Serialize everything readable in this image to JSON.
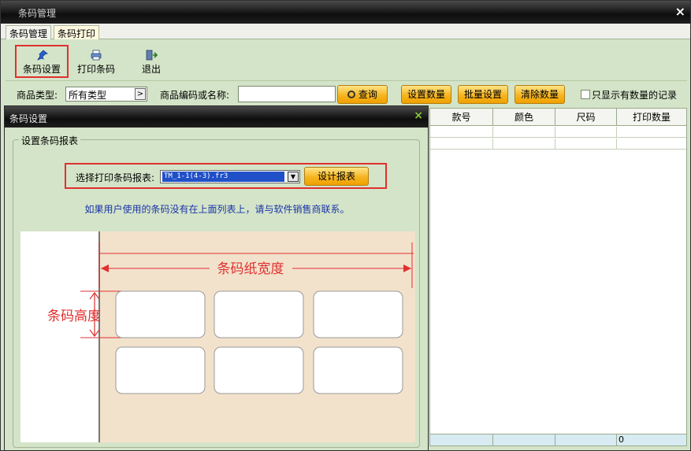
{
  "window": {
    "title": "条码管理",
    "close": "×"
  },
  "tabs": [
    {
      "label": "条码管理"
    },
    {
      "label": "条码打印"
    }
  ],
  "toolbar": {
    "settings_label": "条码设置",
    "print_label": "打印条码",
    "exit_label": "退出"
  },
  "filter": {
    "type_label": "商品类型:",
    "type_value": "所有类型",
    "code_label": "商品编码或名称:",
    "code_value": "",
    "query_label": "查询",
    "set_qty_label": "设置数量",
    "batch_label": "批量设置",
    "clear_label": "清除数量",
    "only_qty_label": "只显示有数量的记录"
  },
  "grid": {
    "columns": [
      "款号",
      "颜色",
      "尺码",
      "打印数量"
    ],
    "footer_total": "0"
  },
  "dialog": {
    "title": "条码设置",
    "close": "×",
    "group_label": "设置条码报表",
    "pick_label": "选择打印条码报表:",
    "report_value": "TM_1-1(4-3).fr3",
    "design_label": "设计报表",
    "hint": "如果用户使用的条码没有在上面列表上，请与软件销售商联系。",
    "width_label": "条码纸宽度",
    "height_label": "条码高度"
  },
  "colors": {
    "accent_red": "#e03030",
    "button_orange": "#f5b520",
    "panel_green": "#d4e4c8",
    "hint_blue": "#1a35a8",
    "paper_beige": "#f2e2cc"
  }
}
